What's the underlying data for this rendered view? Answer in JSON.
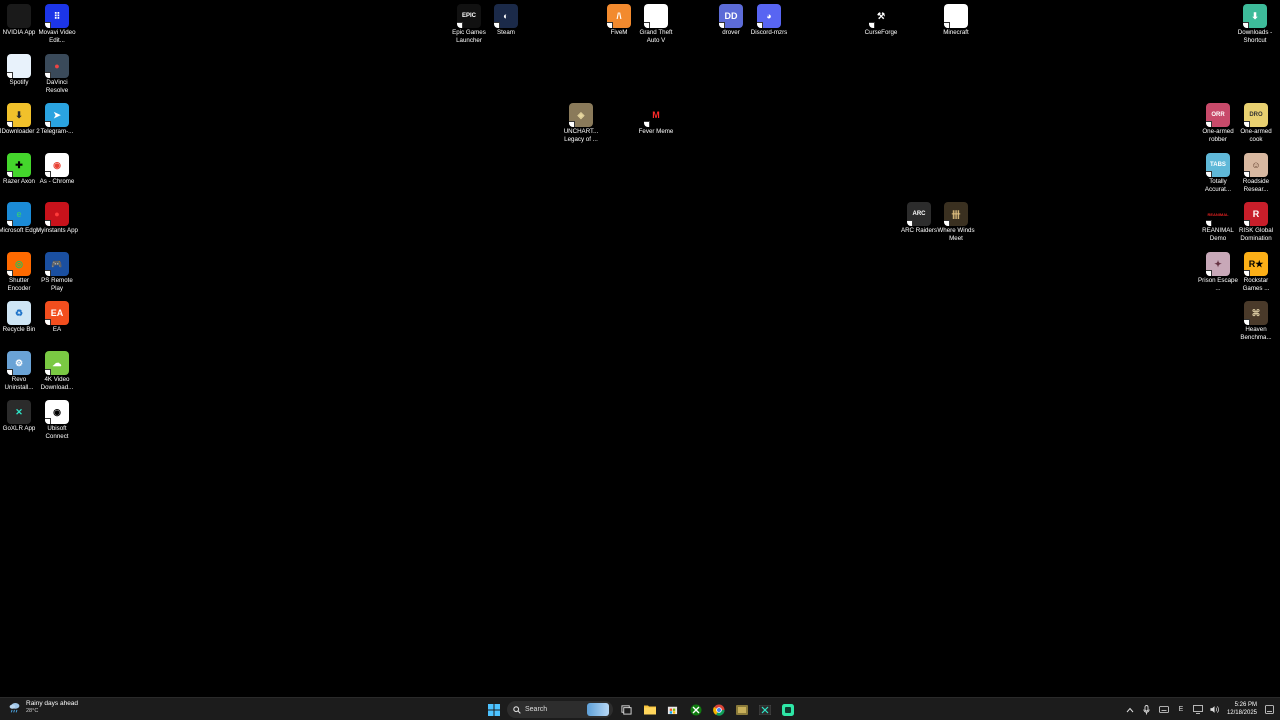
{
  "desktop": {
    "icons": [
      {
        "label": "NVIDIA App",
        "color": "#1a1a1a",
        "glyph": "",
        "accent": "#76b900"
      },
      {
        "label": "Movavi Video Edit...",
        "color": "#1c35e8",
        "glyph": "⠿",
        "accent": "#ffffff"
      },
      {
        "label": "Spotify",
        "color": "#e8f2fb",
        "glyph": "",
        "accent": "#1e73c8"
      },
      {
        "label": "DaVinci Resolve",
        "color": "#3a4a5a",
        "glyph": "●",
        "accent": "#e44"
      },
      {
        "label": "JDownloader 2",
        "color": "#f1c12b",
        "glyph": "⬇",
        "accent": "#2a2a2a"
      },
      {
        "label": "Telegram-...",
        "color": "#2aa3e0",
        "glyph": "➤",
        "accent": "#ffffff"
      },
      {
        "label": "Razer Axon",
        "color": "#44d62c",
        "glyph": "✚",
        "accent": "#000000"
      },
      {
        "label": "As - Chrome",
        "color": "#ffffff",
        "glyph": "◉",
        "accent": "#e94235"
      },
      {
        "label": "Microsoft Edge",
        "color": "#1b8bd6",
        "glyph": "e",
        "accent": "#33c481"
      },
      {
        "label": "Myinstants App",
        "color": "#c8121b",
        "glyph": "●",
        "accent": "#ff3b3b"
      },
      {
        "label": "Shutter Encoder",
        "color": "#ff6a00",
        "glyph": "◎",
        "accent": "#22c55e"
      },
      {
        "label": "PS Remote Play",
        "color": "#1a4fa0",
        "glyph": "🎮",
        "accent": "#ffffff"
      },
      {
        "label": "Recycle Bin",
        "color": "#cfe6f5",
        "glyph": "♻",
        "accent": "#1e73c8"
      },
      {
        "label": "EA",
        "color": "#f24e1e",
        "glyph": "EA",
        "accent": "#ffffff"
      },
      {
        "label": "Revo Uninstall...",
        "color": "#6aa3d6",
        "glyph": "⚙",
        "accent": "#ffffff"
      },
      {
        "label": "4K Video Download...",
        "color": "#7ac943",
        "glyph": "☁",
        "accent": "#ffffff"
      },
      {
        "label": "GoXLR App",
        "color": "#2b2b2b",
        "glyph": "✕",
        "accent": "#2ee6c8"
      },
      {
        "label": "Ubisoft Connect",
        "color": "#ffffff",
        "glyph": "◉",
        "accent": "#000000"
      },
      {
        "label": "Epic Games Launcher",
        "color": "#111111",
        "glyph": "EPIC",
        "accent": "#ffffff"
      },
      {
        "label": "Steam",
        "color": "#1b2a49",
        "glyph": "◐",
        "accent": "#ffffff"
      },
      {
        "label": "FiveM",
        "color": "#f28a2e",
        "glyph": "/\\",
        "accent": "#ffffff"
      },
      {
        "label": "Grand Theft Auto V",
        "color": "#ffffff",
        "glyph": "",
        "accent": "#dddddd"
      },
      {
        "label": "drover",
        "color": "#5c6bd7",
        "glyph": "DD",
        "accent": "#ffffff"
      },
      {
        "label": "Discord-mzrs",
        "color": "#5865f2",
        "glyph": "◕",
        "accent": "#ffffff"
      },
      {
        "label": "CurseForge",
        "color": "#000000",
        "glyph": "⚒",
        "accent": "#ffffff"
      },
      {
        "label": "Minecraft",
        "color": "#ffffff",
        "glyph": "",
        "accent": "#dddddd"
      },
      {
        "label": "Downloads - Shortcut",
        "color": "#3dbb9a",
        "glyph": "⬇",
        "accent": "#ffffff"
      },
      {
        "label": "UNCHART... Legacy of ...",
        "color": "#8a7a5a",
        "glyph": "◈",
        "accent": "#e8d8a0"
      },
      {
        "label": "Fever Meme",
        "color": "#000000",
        "glyph": "M",
        "accent": "#ff2a2a"
      },
      {
        "label": "ARC Raiders",
        "color": "#2c2c2c",
        "glyph": "ARC",
        "accent": "#ffffff"
      },
      {
        "label": "Where Winds Meet",
        "color": "#3a3020",
        "glyph": "卌",
        "accent": "#e0c080"
      },
      {
        "label": "One-armed robber",
        "color": "#c84a6a",
        "glyph": "ORR",
        "accent": "#ffffff"
      },
      {
        "label": "One-armed cook",
        "color": "#e8d070",
        "glyph": "DRO",
        "accent": "#333333"
      },
      {
        "label": "Totally Accurat...",
        "color": "#5fb8d8",
        "glyph": "TABS",
        "accent": "#ffffff"
      },
      {
        "label": "Roadside Resear...",
        "color": "#d8b8a0",
        "glyph": "☺",
        "accent": "#553322"
      },
      {
        "label": "REANIMAL Demo",
        "color": "#000000",
        "glyph": "REANIMAL",
        "accent": "#e02020"
      },
      {
        "label": "RISK Global Domination",
        "color": "#c81e2a",
        "glyph": "R",
        "accent": "#ffffff"
      },
      {
        "label": "Prison Escape ...",
        "color": "#c8a8b8",
        "glyph": "✦",
        "accent": "#663344"
      },
      {
        "label": "Rockstar Games ...",
        "color": "#fcaf17",
        "glyph": "R★",
        "accent": "#000000"
      },
      {
        "label": "Heaven Benchma...",
        "color": "#4a3a2a",
        "glyph": "⌘",
        "accent": "#d8c8a0"
      }
    ]
  },
  "taskbar": {
    "weather_title": "Rainy days ahead",
    "weather_temp": "28°C",
    "search_placeholder": "Search",
    "clock_time": "5:26 PM",
    "clock_date": "12/18/2025",
    "tray_lang": "Е"
  }
}
